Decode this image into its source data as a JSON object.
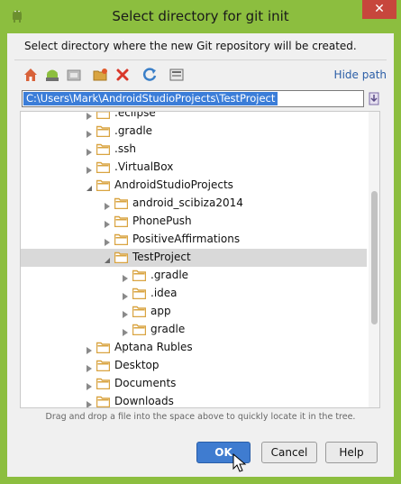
{
  "window": {
    "title": "Select directory for git init",
    "close_glyph": "✕",
    "icon": "android-icon"
  },
  "description": "Select directory where the new Git repository will be created.",
  "toolbar": {
    "icons": [
      "home-icon",
      "android-module-icon",
      "project-folder-icon",
      "new-folder-icon",
      "delete-icon",
      "refresh-icon",
      "show-hidden-icon"
    ],
    "hide_path_label": "Hide path"
  },
  "path_input": {
    "value": "C:\\Users\\Mark\\AndroidStudioProjects\\TestProject"
  },
  "tree": {
    "rows": [
      {
        "label": ".eclipse",
        "depth": 0,
        "expanded": false,
        "selected": false
      },
      {
        "label": ".gradle",
        "depth": 0,
        "expanded": false,
        "selected": false
      },
      {
        "label": ".ssh",
        "depth": 0,
        "expanded": false,
        "selected": false
      },
      {
        "label": ".VirtualBox",
        "depth": 0,
        "expanded": false,
        "selected": false
      },
      {
        "label": "AndroidStudioProjects",
        "depth": 0,
        "expanded": true,
        "selected": false
      },
      {
        "label": "android_scibiza2014",
        "depth": 1,
        "expanded": false,
        "selected": false
      },
      {
        "label": "PhonePush",
        "depth": 1,
        "expanded": false,
        "selected": false
      },
      {
        "label": "PositiveAffirmations",
        "depth": 1,
        "expanded": false,
        "selected": false
      },
      {
        "label": "TestProject",
        "depth": 1,
        "expanded": true,
        "selected": true
      },
      {
        "label": ".gradle",
        "depth": 2,
        "expanded": false,
        "selected": false
      },
      {
        "label": ".idea",
        "depth": 2,
        "expanded": false,
        "selected": false
      },
      {
        "label": "app",
        "depth": 2,
        "expanded": false,
        "selected": false
      },
      {
        "label": "gradle",
        "depth": 2,
        "expanded": false,
        "selected": false
      },
      {
        "label": "Aptana Rubles",
        "depth": 0,
        "expanded": false,
        "selected": false
      },
      {
        "label": "Desktop",
        "depth": 0,
        "expanded": false,
        "selected": false
      },
      {
        "label": "Documents",
        "depth": 0,
        "expanded": false,
        "selected": false
      },
      {
        "label": "Downloads",
        "depth": 0,
        "expanded": false,
        "selected": false
      }
    ]
  },
  "hint": "Drag and drop a file into the space above to quickly locate it in the tree.",
  "buttons": {
    "ok": "OK",
    "cancel": "Cancel",
    "help": "Help"
  },
  "colors": {
    "frame": "#8cbe3f",
    "selection": "#3b7dd8",
    "folder": "#d9a441",
    "close": "#c7463c",
    "link": "#2b5ea7"
  }
}
